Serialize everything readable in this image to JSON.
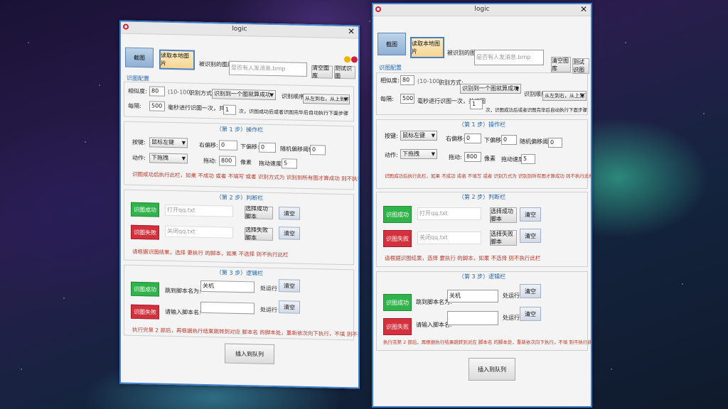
{
  "window": {
    "title": "logic"
  },
  "toolbar": {
    "screenshot_btn": "截图",
    "read_local_btn": "读取本地图片",
    "recognized_label": "被识别的图片:",
    "recognized_placeholder": "是否有人发消息.bmp",
    "clear_btn": "清空图库",
    "test_btn": "测试识图"
  },
  "config": {
    "section_title": "识图配置",
    "similarity_label": "相似度:",
    "similarity_value": "80",
    "similarity_range": "(10-100)",
    "method_label": "识别方式:",
    "method_value": "识别到一个图就算成功",
    "order_label": "识别顺序:",
    "order_value": "从左到右，从上到下",
    "interval_label": "每隔:",
    "interval_value": "500",
    "interval_desc": "毫秒进行识图一次，共识图",
    "count_value": "1",
    "count_desc": "次，识图成功后或者识图完毕后自动执行下面步骤"
  },
  "step1": {
    "title": "（第 1 步）操作栏",
    "key_label": "按键:",
    "key_value": "鼠标左键",
    "right_offset_label": "右偏移:",
    "right_offset_value": "0",
    "down_offset_label": "下偏移:",
    "down_offset_value": "0",
    "random_offset_label": "随机偏移阈值:",
    "random_offset_value": "0",
    "action_label": "动作:",
    "action_value": "下拖拽",
    "drag_label": "拖动:",
    "drag_value": "800",
    "px_label": "像素",
    "drag_speed_label": "拖动速度:",
    "drag_speed_value": "5",
    "note": "识图成功后执行此栏，如果 不成功 或者 不填写 或者 识别方式为 识别到所有图才算成功 则不执行此栏"
  },
  "step2": {
    "title": "（第 2 步）判断栏",
    "success_btn": "识图成功",
    "success_placeholder": "打开qq.txt",
    "success_choose_btn": "选择成功脚本",
    "clear_btn": "清空",
    "fail_btn": "识图失败",
    "fail_placeholder": "关闭qq.txt",
    "fail_choose_btn": "选择失败脚本",
    "note": "请根据识图结果，选择 要执行 的脚本，如果 不选择 则不执行此栏"
  },
  "step3": {
    "title": "（第 3 步）逻辑栏",
    "success_btn": "识图成功",
    "jump_label": "跳到脚本名为:",
    "jump_value": "关机",
    "run_label": "处运行",
    "clear_btn": "清空",
    "fail_btn": "识图失败",
    "input_label": "请输入脚本名:",
    "input_value": "",
    "note": "执行完第 2 部后，再根据执行结果跳转到对应 脚本名 的脚本处，重新依次向下执行，不填 则不执行此栏"
  },
  "insert_btn": "插入到队列",
  "colors": {
    "success": "#2fb34a",
    "fail": "#d5303d",
    "accent": "#3f7fd0",
    "note": "#c0392b"
  }
}
